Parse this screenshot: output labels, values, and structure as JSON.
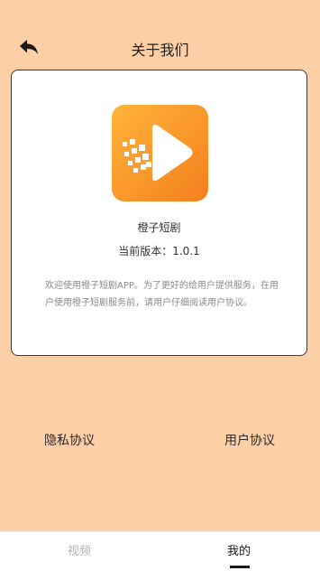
{
  "header": {
    "back_icon": "back-arrow-icon",
    "title": "关于我们"
  },
  "app": {
    "logo_icon": "play-logo-icon",
    "name": "橙子短剧",
    "version_label": "当前版本：",
    "version": "1.0.1",
    "description": "欢迎使用橙子短剧APP。为了更好的给用户提供服务，在用户使用橙子短剧服务前，请用户仔细阅读用户协议。"
  },
  "links": {
    "privacy": "隐私协议",
    "user_agreement": "用户协议"
  },
  "tabbar": {
    "items": [
      {
        "label": "视频",
        "active": false
      },
      {
        "label": "我的",
        "active": true
      }
    ]
  },
  "colors": {
    "background": "#fdcfa6",
    "logo_orange_light": "#ffb43a",
    "logo_orange_dark": "#f47f1e"
  }
}
